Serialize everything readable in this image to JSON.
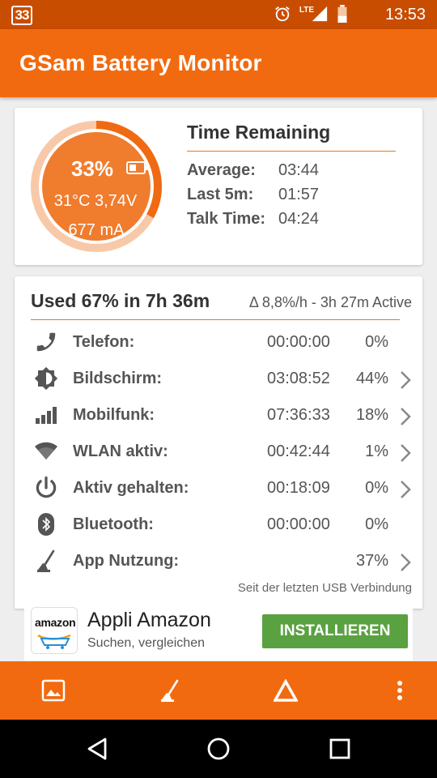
{
  "status_bar": {
    "badge": "33",
    "network": "LTE",
    "time": "13:53",
    "icons": [
      "alarm-icon",
      "signal-icon",
      "battery-low-icon"
    ]
  },
  "app": {
    "title": "GSam Battery Monitor",
    "accent": "#f26a0f",
    "status_color": "#c94d00"
  },
  "battery": {
    "percent_text": "33%",
    "percent_value": 33,
    "temp_voltage": "31°C  3,74V",
    "current": "677 mA"
  },
  "time_remaining": {
    "title": "Time Remaining",
    "rows": [
      {
        "label": "Average:",
        "value": "03:44"
      },
      {
        "label": "Last 5m:",
        "value": "01:57"
      },
      {
        "label": "Talk Time:",
        "value": "04:24"
      }
    ]
  },
  "usage": {
    "title": "Used 67% in 7h 36m",
    "subtitle": "Δ 8,8%/h - 3h 27m Active",
    "rows": [
      {
        "icon": "phone-icon",
        "name": "Telefon:",
        "time": "00:00:00",
        "pct": "0%",
        "chevron": false
      },
      {
        "icon": "screen-brightness-icon",
        "name": "Bildschirm:",
        "time": "03:08:52",
        "pct": "44%",
        "chevron": true
      },
      {
        "icon": "cell-signal-icon",
        "name": "Mobilfunk:",
        "time": "07:36:33",
        "pct": "18%",
        "chevron": true
      },
      {
        "icon": "wifi-icon",
        "name": "WLAN aktiv:",
        "time": "00:42:44",
        "pct": "1%",
        "chevron": true
      },
      {
        "icon": "power-icon",
        "name": "Aktiv gehalten:",
        "time": "00:18:09",
        "pct": "0%",
        "chevron": true
      },
      {
        "icon": "bluetooth-icon",
        "name": "Bluetooth:",
        "time": "00:00:00",
        "pct": "0%",
        "chevron": false
      },
      {
        "icon": "broom-icon",
        "name": "App Nutzung:",
        "time": "",
        "pct": "37%",
        "chevron": true
      }
    ],
    "footnote": "Seit der letzten USB Verbindung"
  },
  "ad": {
    "logo_text": "amazon",
    "title": "Appli Amazon",
    "subtitle": "Suchen, vergleichen",
    "button": "INSTALLIEREN",
    "button_color": "#5aa141"
  },
  "toolbar": {
    "items": [
      "image-icon",
      "broom-icon",
      "delta-icon",
      "more-vert-icon"
    ]
  },
  "navbar": {
    "items": [
      "back-icon",
      "home-icon",
      "recents-icon"
    ]
  }
}
